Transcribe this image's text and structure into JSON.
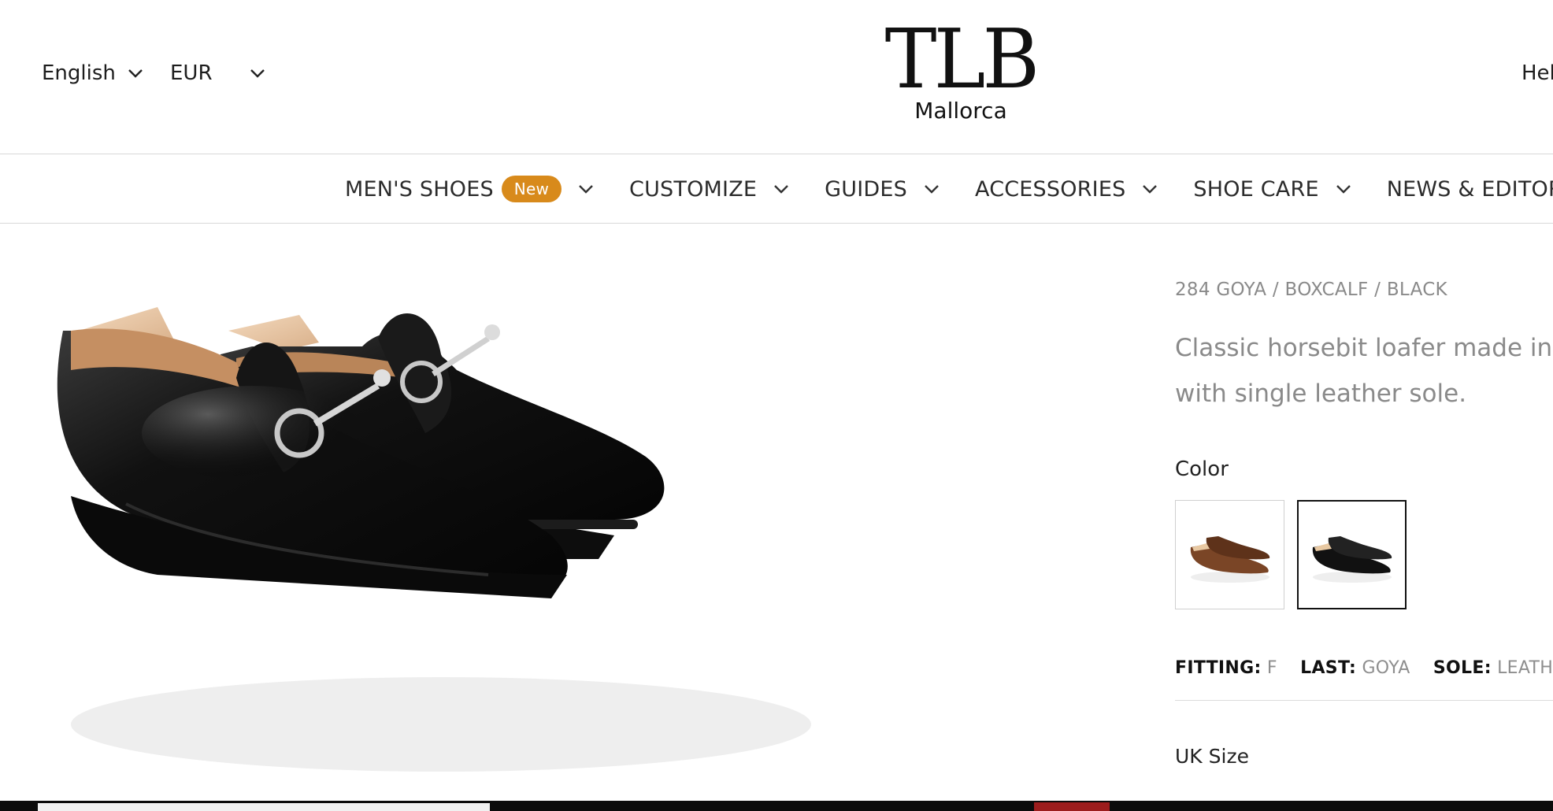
{
  "header": {
    "language": "English",
    "currency": "EUR",
    "logo_mark": "TLB",
    "logo_sub": "Mallorca",
    "help": "Hel"
  },
  "nav": {
    "items": [
      {
        "label": "MEN'S SHOES",
        "badge": "New"
      },
      {
        "label": "CUSTOMIZE"
      },
      {
        "label": "GUIDES"
      },
      {
        "label": "ACCESSORIES"
      },
      {
        "label": "SHOE CARE"
      },
      {
        "label": "NEWS & EDITORIAL"
      }
    ]
  },
  "product": {
    "sku": "284 GOYA / BOXCALF / BLACK",
    "description_line1": "Classic horsebit loafer made in bl",
    "description_line2": "with single leather sole.",
    "color_label": "Color",
    "colors": [
      {
        "name": "brown",
        "hex": "#7a4526",
        "selected": false
      },
      {
        "name": "black",
        "hex": "#111111",
        "selected": true
      }
    ],
    "specs": {
      "fitting_label": "FITTING:",
      "fitting_value": "F",
      "last_label": "LAST:",
      "last_value": "GOYA",
      "sole_label": "SOLE:",
      "sole_value": "LEATHER"
    },
    "size_label": "UK Size"
  },
  "colors": {
    "badge": "#d88a1b",
    "muted_text": "#8a8a8a",
    "divider": "#d9d9d9"
  }
}
